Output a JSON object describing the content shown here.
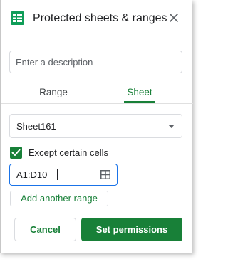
{
  "header": {
    "title": "Protected sheets & ranges",
    "icon": "sheets-icon",
    "close_icon": "close-icon"
  },
  "description": {
    "placeholder": "Enter a description",
    "value": ""
  },
  "tabs": [
    {
      "label": "Range",
      "selected": false
    },
    {
      "label": "Sheet",
      "selected": true
    }
  ],
  "sheet_select": {
    "selected": "Sheet161",
    "icon": "dropdown-arrow-icon"
  },
  "except_cells": {
    "label": "Except certain cells",
    "checked": true
  },
  "range_field": {
    "value": "A1:D10",
    "icon": "grid-select-icon"
  },
  "buttons": {
    "add_range": "Add another range",
    "cancel": "Cancel",
    "set_permissions": "Set permissions"
  },
  "colors": {
    "accent_green": "#188038",
    "focus_blue": "#1a73e8",
    "sheets_icon_green": "#0f9d58"
  }
}
